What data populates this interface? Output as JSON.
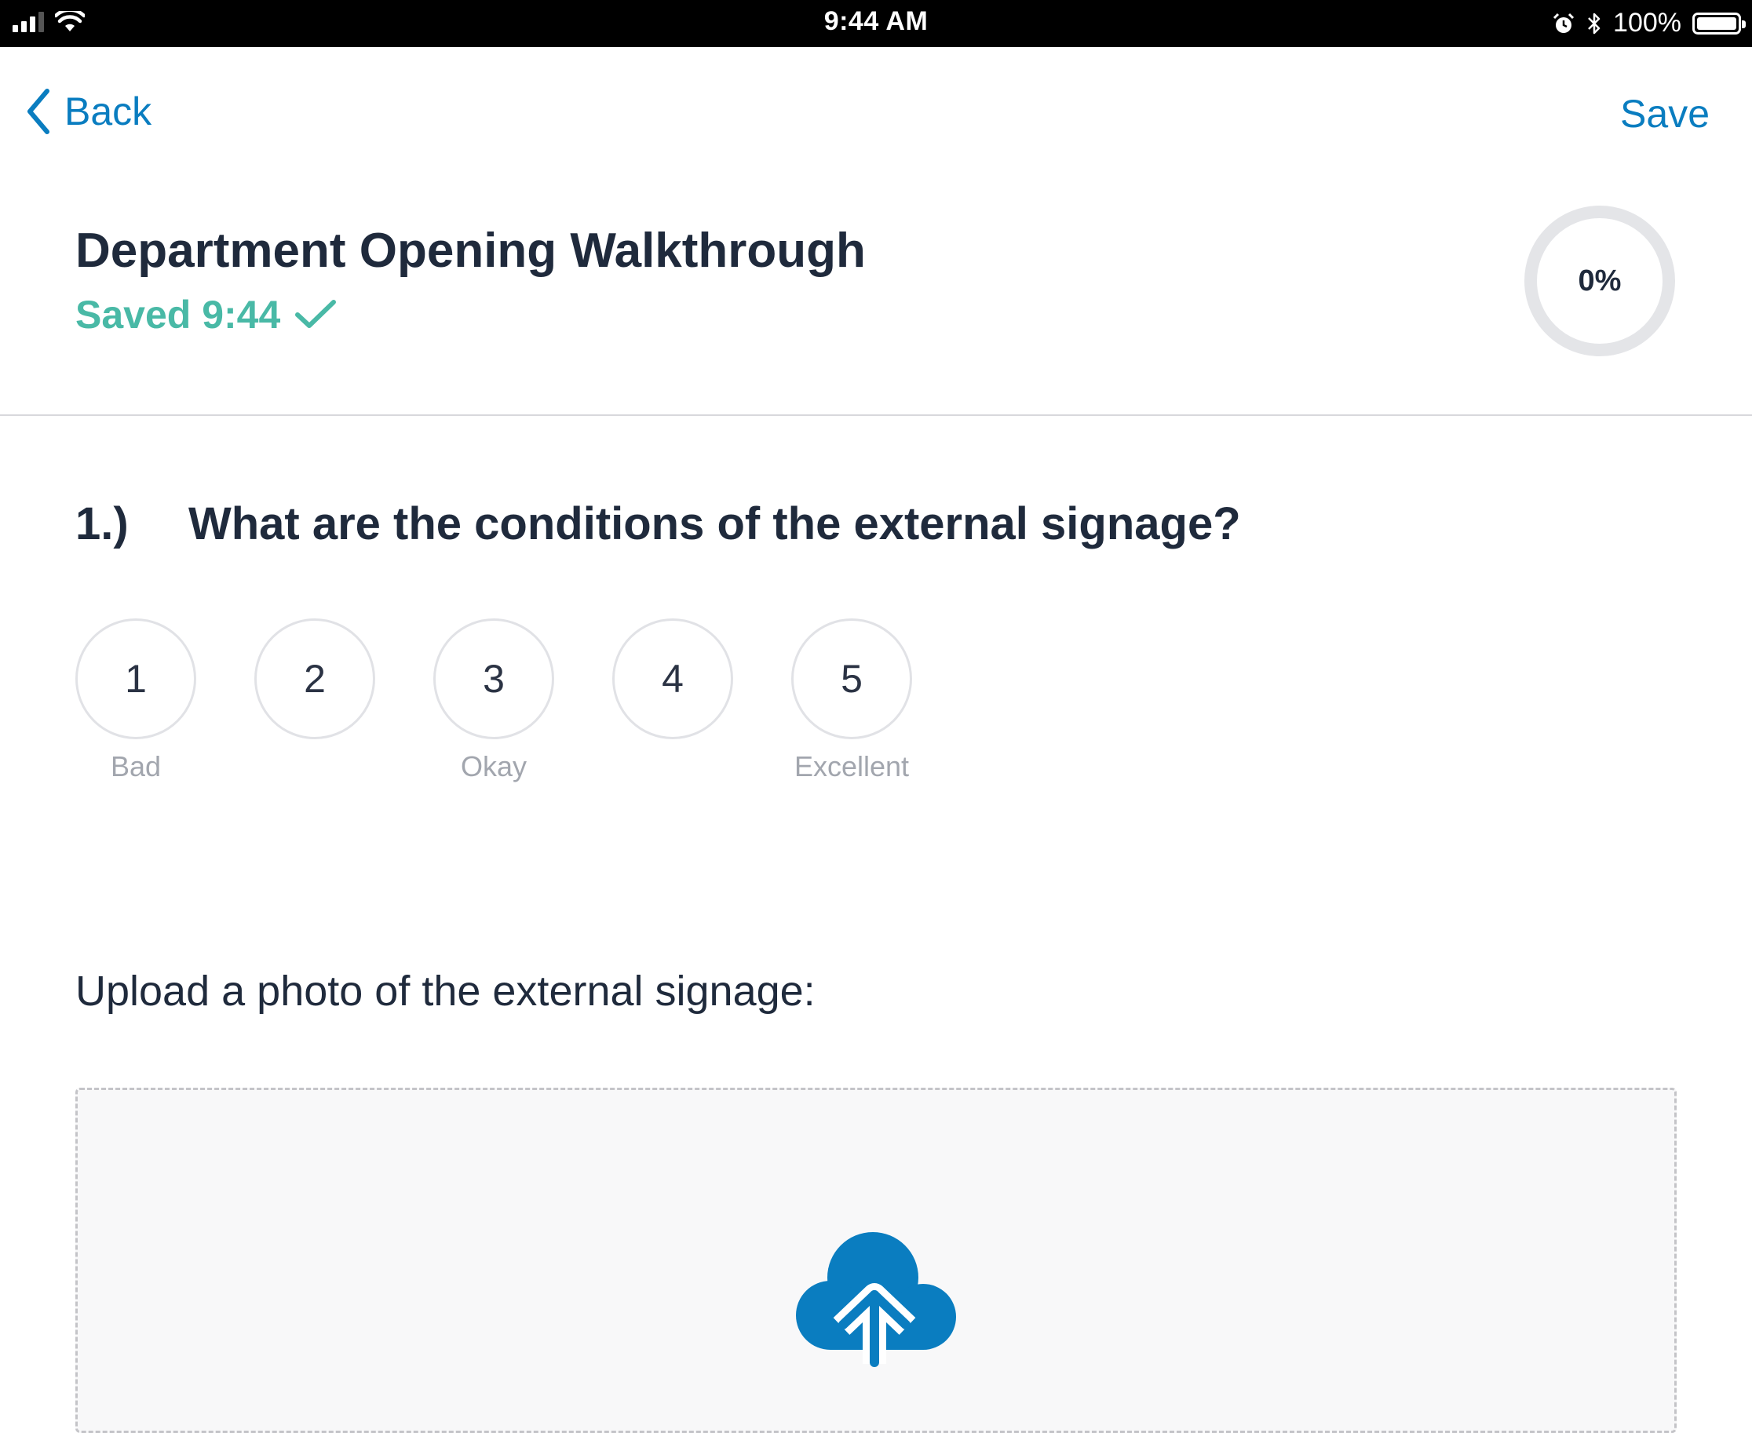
{
  "status_bar": {
    "time": "9:44 AM",
    "battery_percent": "100%",
    "icons": [
      "cellular-signal-icon",
      "wifi-icon",
      "alarm-icon",
      "bluetooth-icon",
      "battery-icon"
    ],
    "battery_level": 1.0
  },
  "nav": {
    "back_label": "Back",
    "save_label": "Save"
  },
  "header": {
    "title": "Department Opening Walkthrough",
    "saved_text": "Saved 9:44",
    "progress_label": "0%",
    "progress_value": 0
  },
  "question": {
    "number": "1.)",
    "text": "What are the conditions of the external signage?",
    "options": [
      {
        "value": "1",
        "caption": "Bad"
      },
      {
        "value": "2",
        "caption": ""
      },
      {
        "value": "3",
        "caption": "Okay"
      },
      {
        "value": "4",
        "caption": ""
      },
      {
        "value": "5",
        "caption": "Excellent"
      }
    ]
  },
  "upload": {
    "label": "Upload a photo of the external signage:",
    "icon": "cloud-upload-icon"
  },
  "colors": {
    "accent": "#0a7dc0",
    "success": "#49b9a6",
    "text": "#1f2a3c",
    "muted": "#a2a6ae",
    "ring": "#e4e5e8"
  }
}
